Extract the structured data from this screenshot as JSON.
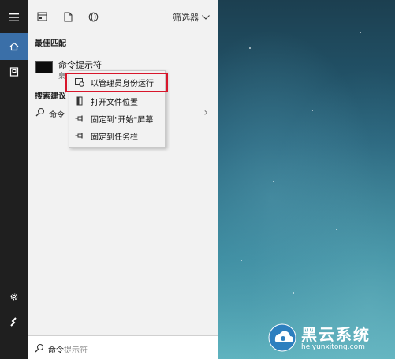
{
  "rail": {
    "icons": [
      "hamburger-menu-icon",
      "home-icon",
      "document-icon",
      "settings-icon",
      "user-icon"
    ],
    "active_color": "#3a6fa8",
    "background": "#1f1f1f"
  },
  "panel_top": {
    "icons": [
      "apps-icon",
      "document-icon",
      "web-globe-icon"
    ],
    "filter_label": "筛选器"
  },
  "best_match": {
    "heading": "最佳匹配",
    "item": {
      "name": "命令提示符",
      "subtitle": "桌"
    }
  },
  "web_search": {
    "heading": "搜索建议",
    "query": "命令"
  },
  "context_menu": {
    "items": [
      {
        "label": "以管理员身份运行",
        "icon": "shield-run-icon"
      },
      {
        "label": "打开文件位置",
        "icon": "file-location-icon"
      },
      {
        "label": "固定到\"开始\"屏幕",
        "icon": "pin-icon"
      },
      {
        "label": "固定到任务栏",
        "icon": "pin-icon"
      }
    ],
    "highlight_color": "#d8162b"
  },
  "searchbar": {
    "typed": "命令",
    "ghost": "提示符"
  },
  "watermark": {
    "title": "黑云系统",
    "url": "heiyunxitong.com"
  }
}
